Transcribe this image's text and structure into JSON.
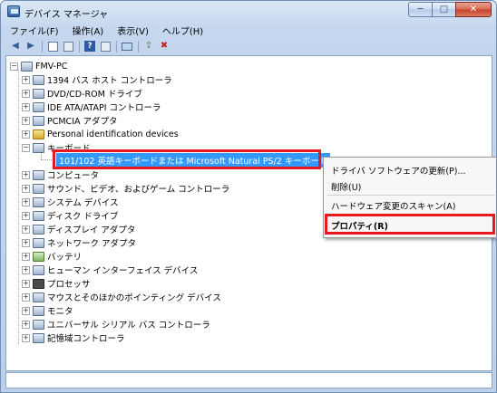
{
  "window": {
    "title": "デバイス マネージャ"
  },
  "window_buttons": {
    "minimize": "─",
    "maximize": "□",
    "close": "✕"
  },
  "menu": [
    "ファイル(F)",
    "操作(A)",
    "表示(V)",
    "ヘルプ(H)"
  ],
  "toolbar_icons": [
    "back-arrow-icon",
    "forward-arrow-icon",
    "properties-icon",
    "view-icon",
    "help-icon",
    "device-icon",
    "scan-icon",
    "update-icon",
    "uninstall-icon"
  ],
  "tree": {
    "root": "FMV-PC",
    "items": [
      {
        "label": "1394 バス ホスト コントローラ",
        "expander": "+"
      },
      {
        "label": "DVD/CD-ROM ドライブ",
        "expander": "+"
      },
      {
        "label": "IDE ATA/ATAPI コントローラ",
        "expander": "+"
      },
      {
        "label": "PCMCIA アダプタ",
        "expander": "+"
      },
      {
        "label": "Personal identification devices",
        "expander": "+"
      },
      {
        "label": "キーボード",
        "expander": "−"
      },
      {
        "label": "コンピュータ",
        "expander": "+"
      },
      {
        "label": "サウンド、ビデオ、およびゲーム コントローラ",
        "expander": "+"
      },
      {
        "label": "システム デバイス",
        "expander": "+"
      },
      {
        "label": "ディスク ドライブ",
        "expander": "+"
      },
      {
        "label": "ディスプレイ アダプタ",
        "expander": "+"
      },
      {
        "label": "ネットワーク アダプタ",
        "expander": "+"
      },
      {
        "label": "バッテリ",
        "expander": "+"
      },
      {
        "label": "ヒューマン インターフェイス デバイス",
        "expander": "+"
      },
      {
        "label": "プロセッサ",
        "expander": "+"
      },
      {
        "label": "マウスとそのほかのポインティング デバイス",
        "expander": "+"
      },
      {
        "label": "モニタ",
        "expander": "+"
      },
      {
        "label": "ユニバーサル シリアル バス コントローラ",
        "expander": "+"
      },
      {
        "label": "記憶域コントローラ",
        "expander": "+"
      }
    ],
    "selected_child": "101/102 英語キーボードまたは Microsoft Natural PS/2 キーボード"
  },
  "context_menu": {
    "update_driver": "ドライバ ソフトウェアの更新(P)...",
    "uninstall": "削除(U)",
    "scan": "ハードウェア変更のスキャン(A)",
    "properties": "プロパティ(R)"
  },
  "colors": {
    "selection": "#3399ff",
    "highlight": "#e8181e"
  }
}
